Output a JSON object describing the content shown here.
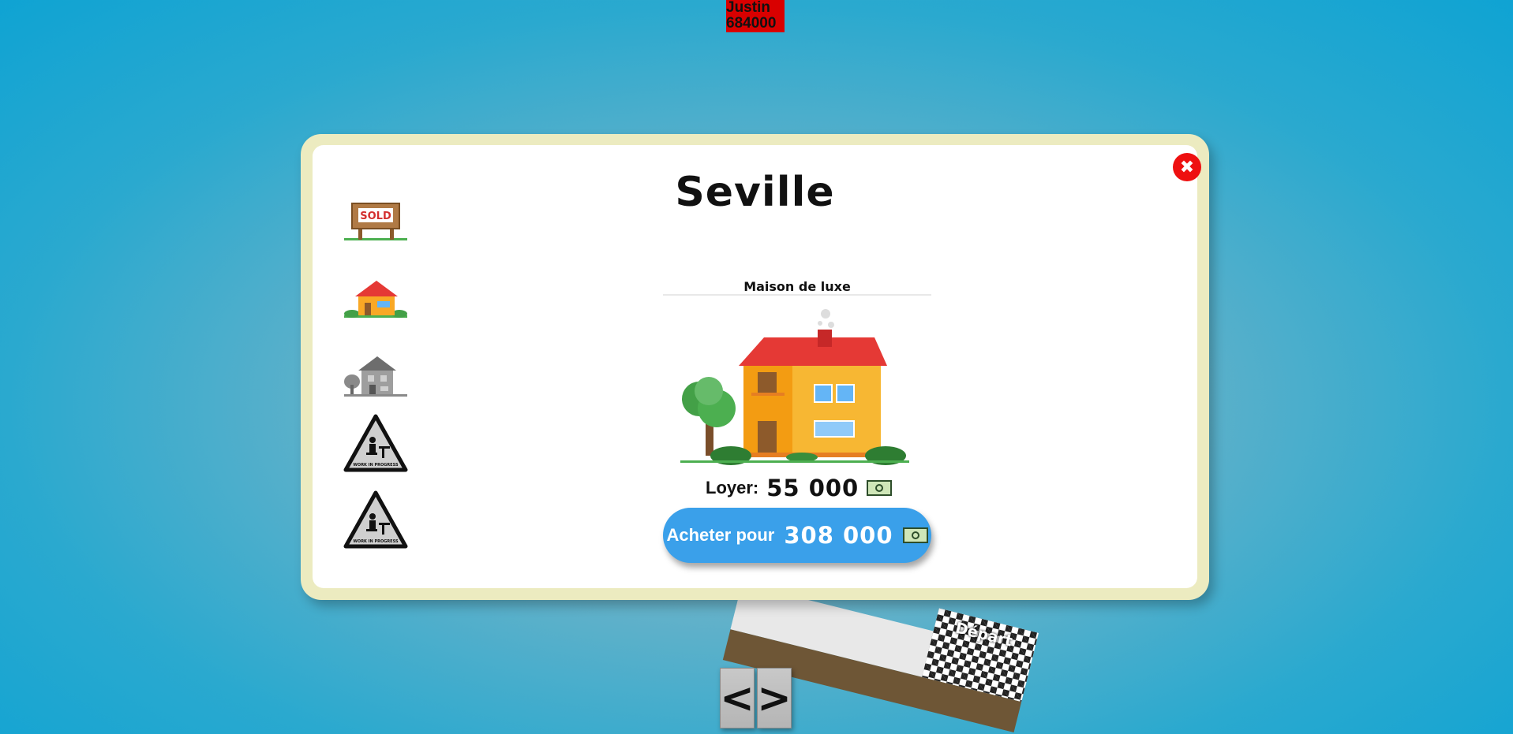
{
  "player": {
    "name": "Justin",
    "money": "684000"
  },
  "board": {
    "start_label": "Départ"
  },
  "nav": {
    "prev_label": "<",
    "next_label": ">"
  },
  "modal": {
    "title": "Seville",
    "close_icon": "close-icon",
    "level_icons": [
      "sold-sign-icon",
      "small-house-icon",
      "villa-grey-icon",
      "work-in-progress-icon",
      "work-in-progress-icon"
    ],
    "level_name": "Maison de luxe",
    "rent_label": "Loyer:",
    "rent_value": "55 000",
    "buy_label": "Acheter pour",
    "buy_price": "308 000",
    "currency_icon": "banknote-icon"
  },
  "colors": {
    "player_badge": "#d90000",
    "buy_button": "#3aa0ea",
    "close_button": "#ee1010",
    "modal_frame": "#ecebc0"
  }
}
